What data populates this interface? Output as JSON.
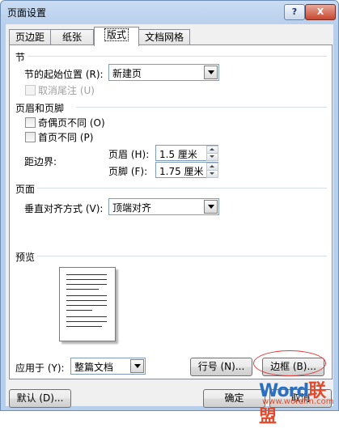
{
  "window": {
    "title": "页面设置",
    "help_label": "?",
    "close_label": "X"
  },
  "tabs": [
    {
      "label": "页边距"
    },
    {
      "label": "纸张"
    },
    {
      "label": "版式"
    },
    {
      "label": "文档网格"
    }
  ],
  "section": {
    "heading": "节",
    "start_label": "节的起始位置 (R):",
    "start_value": "新建页",
    "suppress_endnotes_label": "取消尾注 (U)"
  },
  "headers_footers": {
    "heading": "页眉和页脚",
    "odd_even_label": "奇偶页不同 (O)",
    "first_page_label": "首页不同 (P)",
    "from_edge_label": "距边界:",
    "header_label": "页眉 (H):",
    "header_value": "1.5 厘米",
    "footer_label": "页脚 (F):",
    "footer_value": "1.75 厘米"
  },
  "page": {
    "heading": "页面",
    "valign_label": "垂直对齐方式 (V):",
    "valign_value": "顶端对齐"
  },
  "preview": {
    "heading": "预览"
  },
  "apply": {
    "label": "应用于 (Y):",
    "value": "整篇文档"
  },
  "buttons": {
    "line_numbers": "行号 (N)...",
    "borders": "边框 (B)...",
    "default": "默认 (D)...",
    "ok": "确定",
    "cancel": "取消"
  },
  "watermark": {
    "brand_latin": "Word",
    "brand_cn": "联盟",
    "url": "www.wordlm.com"
  }
}
